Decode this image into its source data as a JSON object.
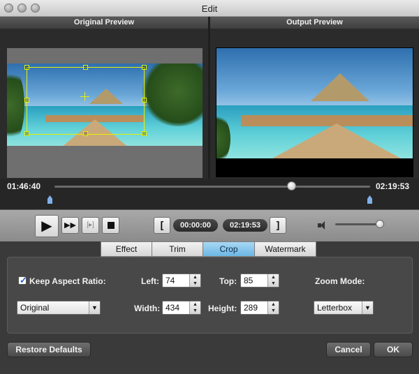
{
  "window": {
    "title": "Edit"
  },
  "preview": {
    "original_label": "Original Preview",
    "output_label": "Output Preview"
  },
  "timeline": {
    "start_time": "01:46:40",
    "end_time": "02:19:53",
    "playhead_fraction": 0.75
  },
  "playback": {
    "play_icon": "play-icon",
    "fast_forward_icon": "fast-forward-icon",
    "frame_icon": "frame-step-icon",
    "stop_icon": "stop-icon",
    "mark_in_label": "[",
    "mark_out_label": "]",
    "segment_start": "00:00:00",
    "segment_end": "02:19:53",
    "volume_icon": "speaker-icon",
    "volume_fraction": 0.92
  },
  "tabs": [
    {
      "label": "Effect",
      "active": false
    },
    {
      "label": "Trim",
      "active": false
    },
    {
      "label": "Crop",
      "active": true
    },
    {
      "label": "Watermark",
      "active": false
    }
  ],
  "crop": {
    "keep_aspect_label": "Keep Aspect Ratio:",
    "keep_aspect_checked": true,
    "aspect_select": "Original",
    "left_label": "Left:",
    "left_value": "74",
    "top_label": "Top:",
    "top_value": "85",
    "width_label": "Width:",
    "width_value": "434",
    "height_label": "Height:",
    "height_value": "289",
    "zoom_label": "Zoom Mode:",
    "zoom_select": "Letterbox"
  },
  "footer": {
    "restore_label": "Restore Defaults",
    "cancel_label": "Cancel",
    "ok_label": "OK"
  },
  "colors": {
    "crop_frame": "#e8f000",
    "active_tab": "#6bb7e4",
    "marker": "#7fb0e8"
  }
}
